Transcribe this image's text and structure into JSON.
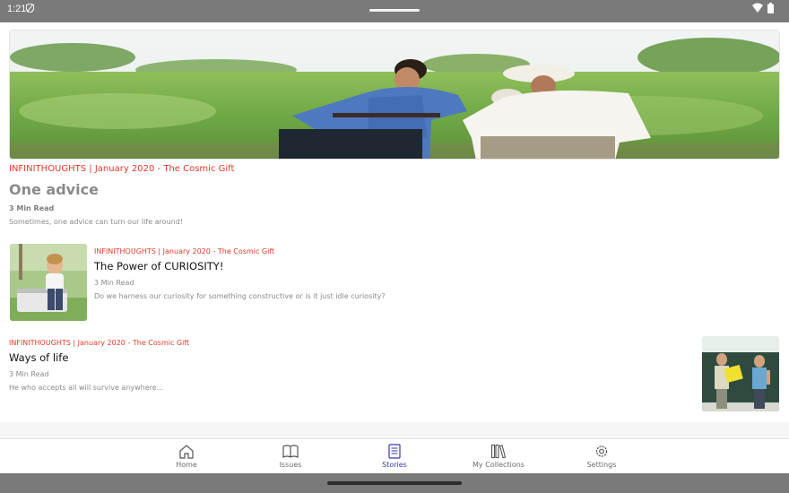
{
  "status_bar": {
    "time": "1:21"
  },
  "hero": {
    "meta": "INFINITHOUGHTS | January 2020 - The Cosmic Gift",
    "title": "One advice",
    "read_time": "3 Min Read",
    "description": "Sometimes, one advice can turn our life around!"
  },
  "stories": [
    {
      "meta": "INFINITHOUGHTS | January 2020 - The Cosmic Gift",
      "title": "The Power of CURIOSITY!",
      "read_time": "3 Min Read",
      "description": "Do we harness our curiosity for something constructive or is it just idle curiosity?"
    },
    {
      "meta": "INFINITHOUGHTS | January 2020 - The Cosmic Gift",
      "title": "Ways of life",
      "read_time": "3 Min Read",
      "description": "He who accepts all will survive anywhere..."
    }
  ],
  "nav": {
    "items": [
      {
        "label": "Home",
        "icon": "home-icon"
      },
      {
        "label": "Issues",
        "icon": "open-book-icon"
      },
      {
        "label": "Stories",
        "icon": "document-icon"
      },
      {
        "label": "My Collections",
        "icon": "library-icon"
      },
      {
        "label": "Settings",
        "icon": "gear-icon"
      }
    ],
    "active": "Stories"
  },
  "colors": {
    "accent_red": "#e23a2a",
    "active_nav": "#3a3aa8"
  }
}
